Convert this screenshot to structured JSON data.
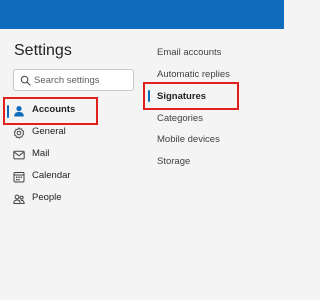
{
  "settings": {
    "title": "Settings",
    "search_placeholder": "Search settings"
  },
  "nav": {
    "items": [
      {
        "label": "Accounts",
        "icon": "person-icon",
        "active": true
      },
      {
        "label": "General",
        "icon": "gear-icon",
        "active": false
      },
      {
        "label": "Mail",
        "icon": "mail-icon",
        "active": false
      },
      {
        "label": "Calendar",
        "icon": "calendar-icon",
        "active": false
      },
      {
        "label": "People",
        "icon": "people-icon",
        "active": false
      }
    ]
  },
  "accounts_menu": {
    "items": [
      {
        "label": "Email accounts",
        "active": false
      },
      {
        "label": "Automatic replies",
        "active": false
      },
      {
        "label": "Signatures",
        "active": true
      },
      {
        "label": "Categories",
        "active": false
      },
      {
        "label": "Mobile devices",
        "active": false
      },
      {
        "label": "Storage",
        "active": false
      }
    ]
  },
  "colors": {
    "brand": "#0f6cbd",
    "highlight_box": "#e0201b",
    "background": "#f4f4f4"
  }
}
